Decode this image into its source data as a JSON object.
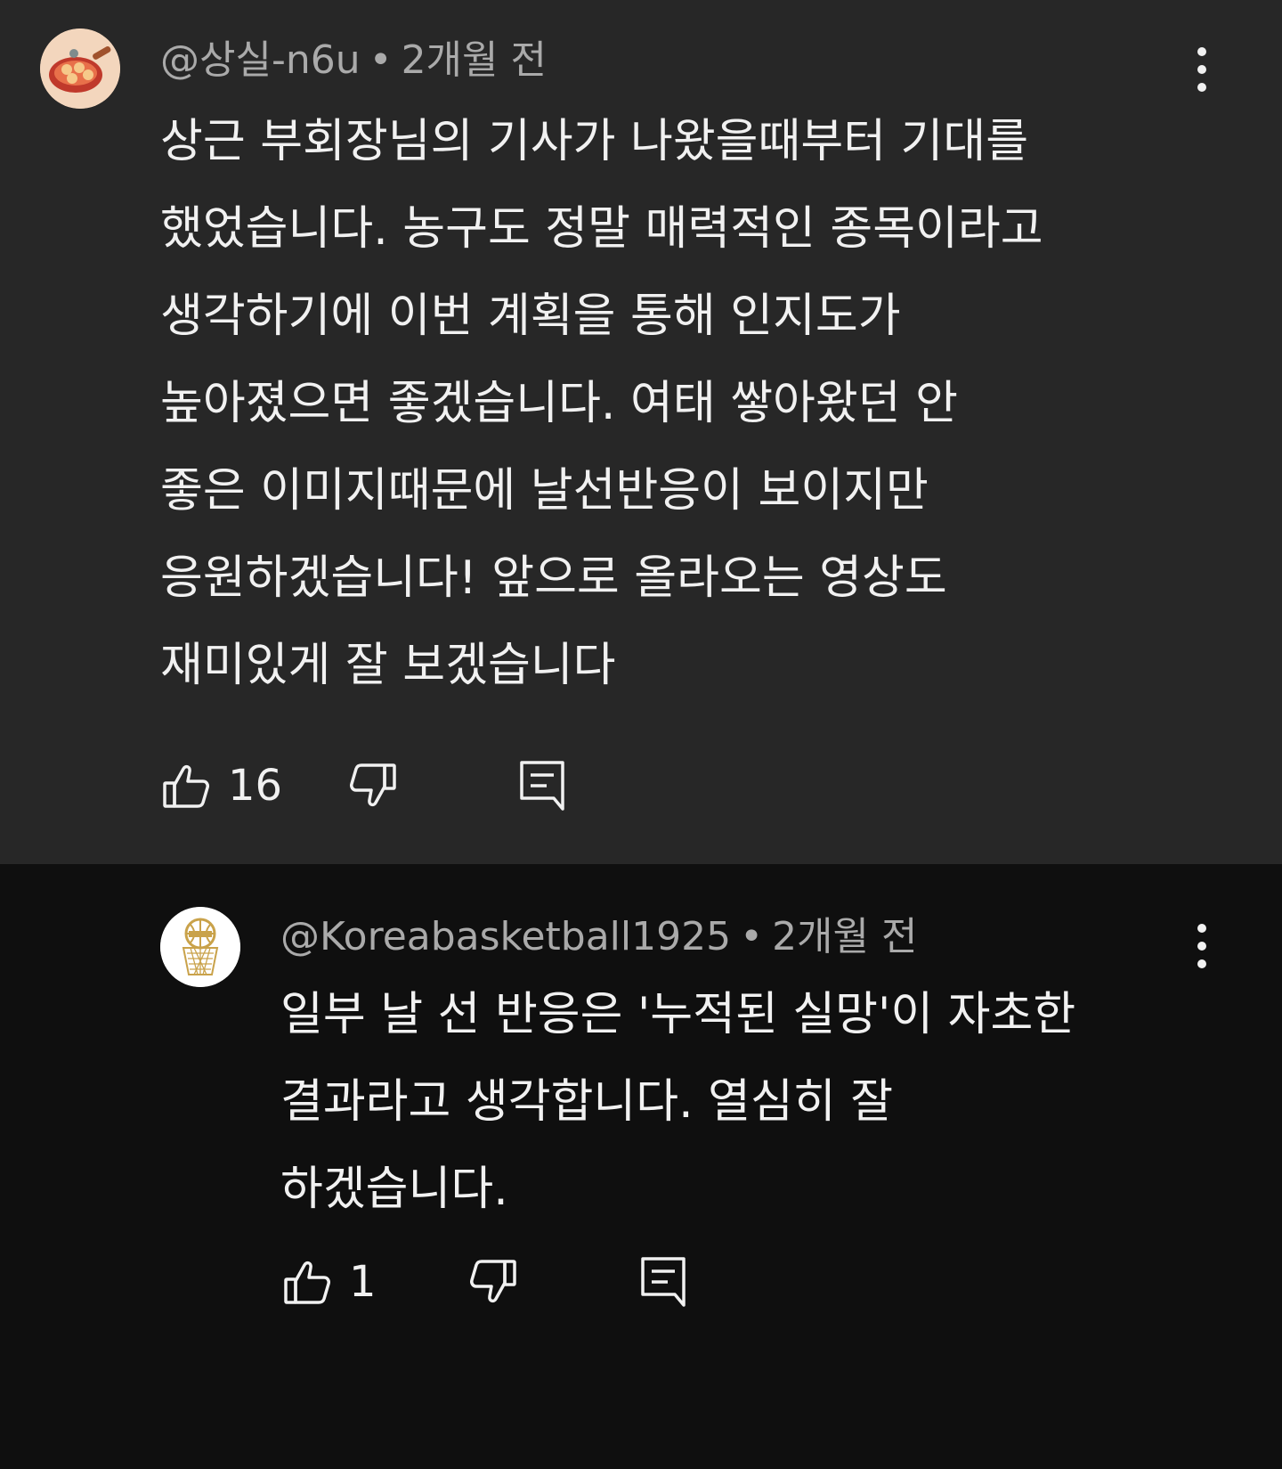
{
  "comments": [
    {
      "author": "@상실-n6u",
      "separator": "•",
      "time": "2개월 전",
      "lines": [
        "상근 부회장님의 기사가 나왔을때부터 기대를",
        "했었습니다. 농구도 정말 매력적인 종목이라고",
        "생각하기에 이번 계획을 통해 인지도가",
        "높아졌으면 좋겠습니다. 여태 쌓아왔던 안",
        "좋은 이미지때문에 날선반응이 보이지만",
        "응원하겠습니다! 앞으로 올라오는 영상도",
        "재미있게 잘 보겠습니다"
      ],
      "like_count": "16",
      "avatar_icon": "food-plate-icon",
      "background": "#272727"
    },
    {
      "author": "@Koreabasketball1925",
      "separator": "•",
      "time": "2개월 전",
      "lines": [
        "일부 날 선 반응은 '누적된 실망'이 자초한",
        "결과라고 생각합니다. 열심히 잘",
        "하겠습니다."
      ],
      "like_count": "1",
      "avatar_icon": "basketball-hoop-logo-icon",
      "background": "#0f0f0f"
    }
  ],
  "colors": {
    "text_primary": "#f1f1f1",
    "text_secondary": "#aaaaaa",
    "gold": "#c9a24a"
  }
}
